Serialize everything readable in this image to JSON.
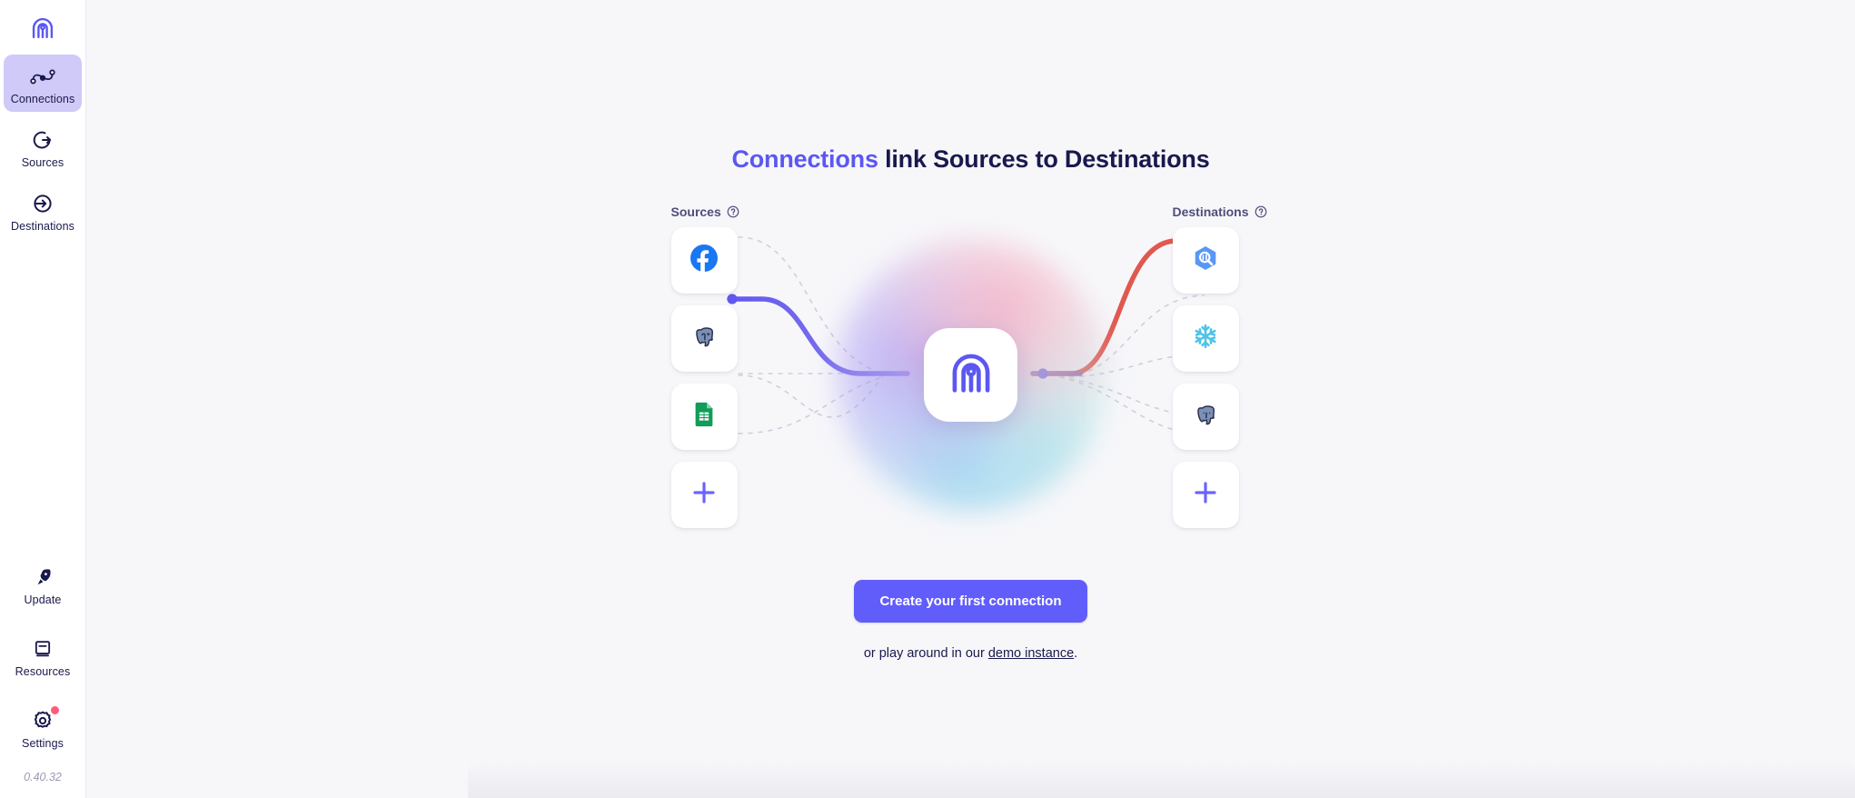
{
  "app": {
    "brand_icon": "airbyte-logo-icon"
  },
  "sidebar": {
    "items": [
      {
        "label": "Connections",
        "icon": "connections-icon",
        "active": true
      },
      {
        "label": "Sources",
        "icon": "sources-icon",
        "active": false
      },
      {
        "label": "Destinations",
        "icon": "destinations-icon",
        "active": false
      }
    ],
    "bottom_items": [
      {
        "label": "Update",
        "icon": "rocket-icon",
        "badge": false
      },
      {
        "label": "Resources",
        "icon": "book-icon",
        "badge": false
      },
      {
        "label": "Settings",
        "icon": "gear-icon",
        "badge": true
      }
    ],
    "version": "0.40.32"
  },
  "main": {
    "title_accent": "Connections",
    "title_rest": " link Sources to Destinations",
    "sources_label": "Sources",
    "destinations_label": "Destinations",
    "help_icon": "question-circle-icon",
    "sources_nodes": [
      {
        "name": "facebook",
        "icon": "facebook-icon"
      },
      {
        "name": "postgres",
        "icon": "postgresql-icon"
      },
      {
        "name": "google-sheets",
        "icon": "google-sheets-icon"
      },
      {
        "name": "add-source",
        "icon": "plus-icon"
      }
    ],
    "destination_nodes": [
      {
        "name": "bigquery",
        "icon": "bigquery-icon"
      },
      {
        "name": "snowflake",
        "icon": "snowflake-icon"
      },
      {
        "name": "postgres",
        "icon": "postgresql-icon"
      },
      {
        "name": "add-destination",
        "icon": "plus-icon"
      }
    ],
    "center_node": {
      "name": "airbyte",
      "icon": "airbyte-logo-icon"
    },
    "cta_label": "Create your first connection",
    "sub_prefix": "or play around in our ",
    "sub_link": "demo instance",
    "sub_suffix": "."
  },
  "colors": {
    "brand": "#615dfb",
    "accent_text": "#5b57f2",
    "active_nav_bg": "#cfcaf7",
    "dark_text": "#1a194d",
    "muted_text": "#4f4d7a",
    "badge": "#ff5c7a",
    "edge_purple": "#6c63ff",
    "edge_red": "#e8594b",
    "page_bg": "#f7f7fa"
  }
}
